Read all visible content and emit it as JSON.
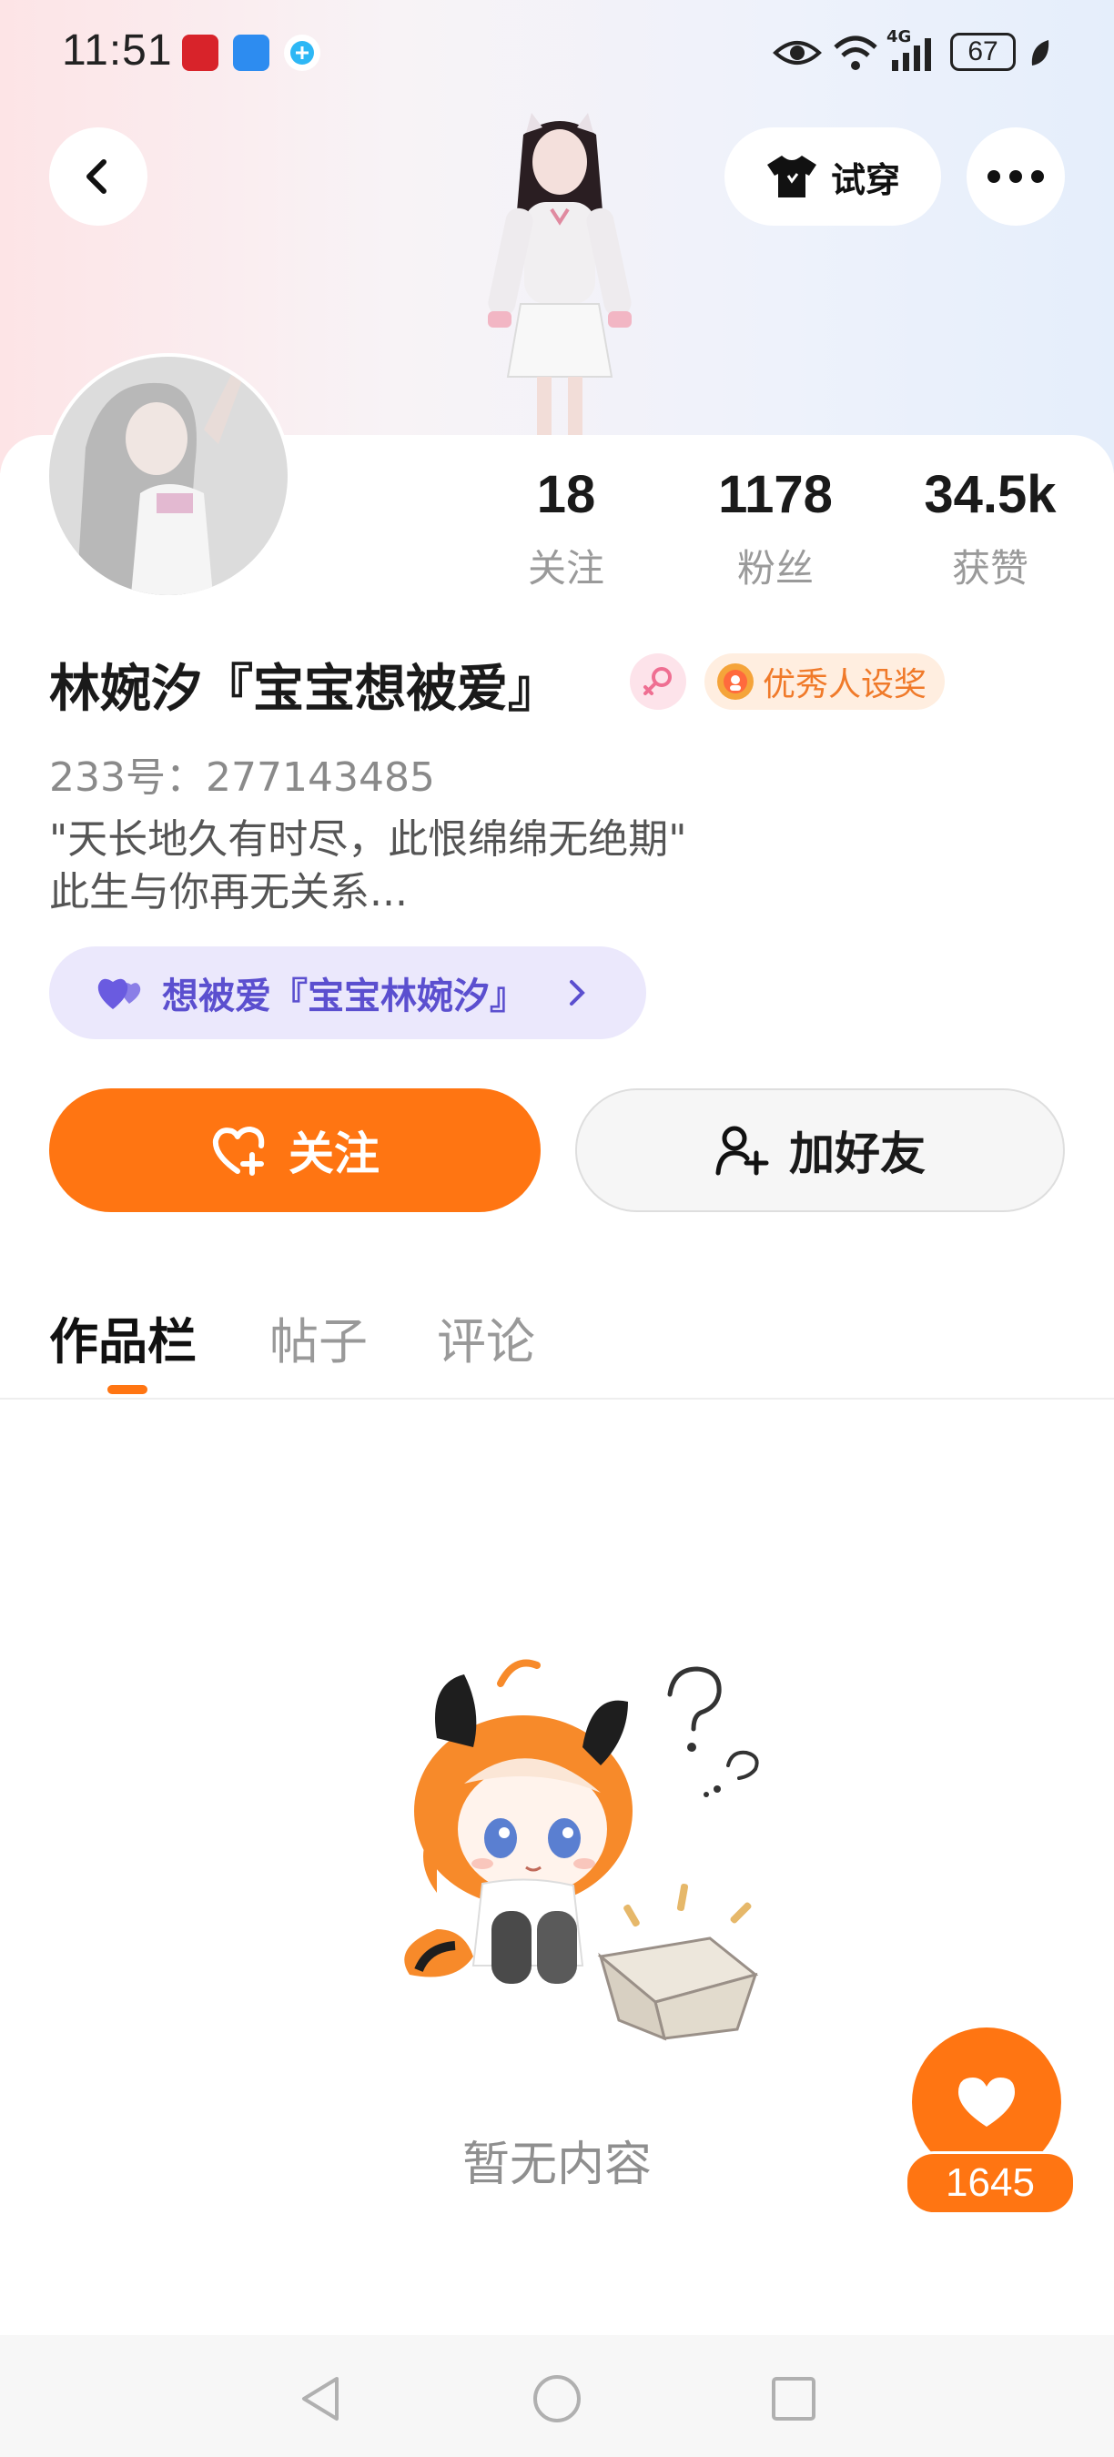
{
  "status_bar": {
    "time": "11:51",
    "battery": "67",
    "network": "4G"
  },
  "header": {
    "try_on_label": "试穿"
  },
  "profile": {
    "name": "林婉汐『宝宝想被爱』",
    "award": "优秀人设奖",
    "uid": "233号：277143485",
    "bio_line1": "\"天长地久有时尽，此恨绵绵无绝期\"",
    "bio_line2": "此生与你再无关系...",
    "group_label": "想被爱『宝宝林婉汐』"
  },
  "stats": [
    {
      "value": "18",
      "label": "关注"
    },
    {
      "value": "1178",
      "label": "粉丝"
    },
    {
      "value": "34.5k",
      "label": "获赞"
    }
  ],
  "actions": {
    "follow_label": "关注",
    "add_friend_label": "加好友"
  },
  "tabs": [
    {
      "label": "作品栏",
      "active": true
    },
    {
      "label": "帖子",
      "active": false
    },
    {
      "label": "评论",
      "active": false
    }
  ],
  "empty": {
    "text": "暂无内容"
  },
  "like": {
    "count": "1645"
  },
  "colors": {
    "accent": "#ff7512",
    "group_bg": "#ebe8fc",
    "group_text": "#5b4fcf"
  }
}
